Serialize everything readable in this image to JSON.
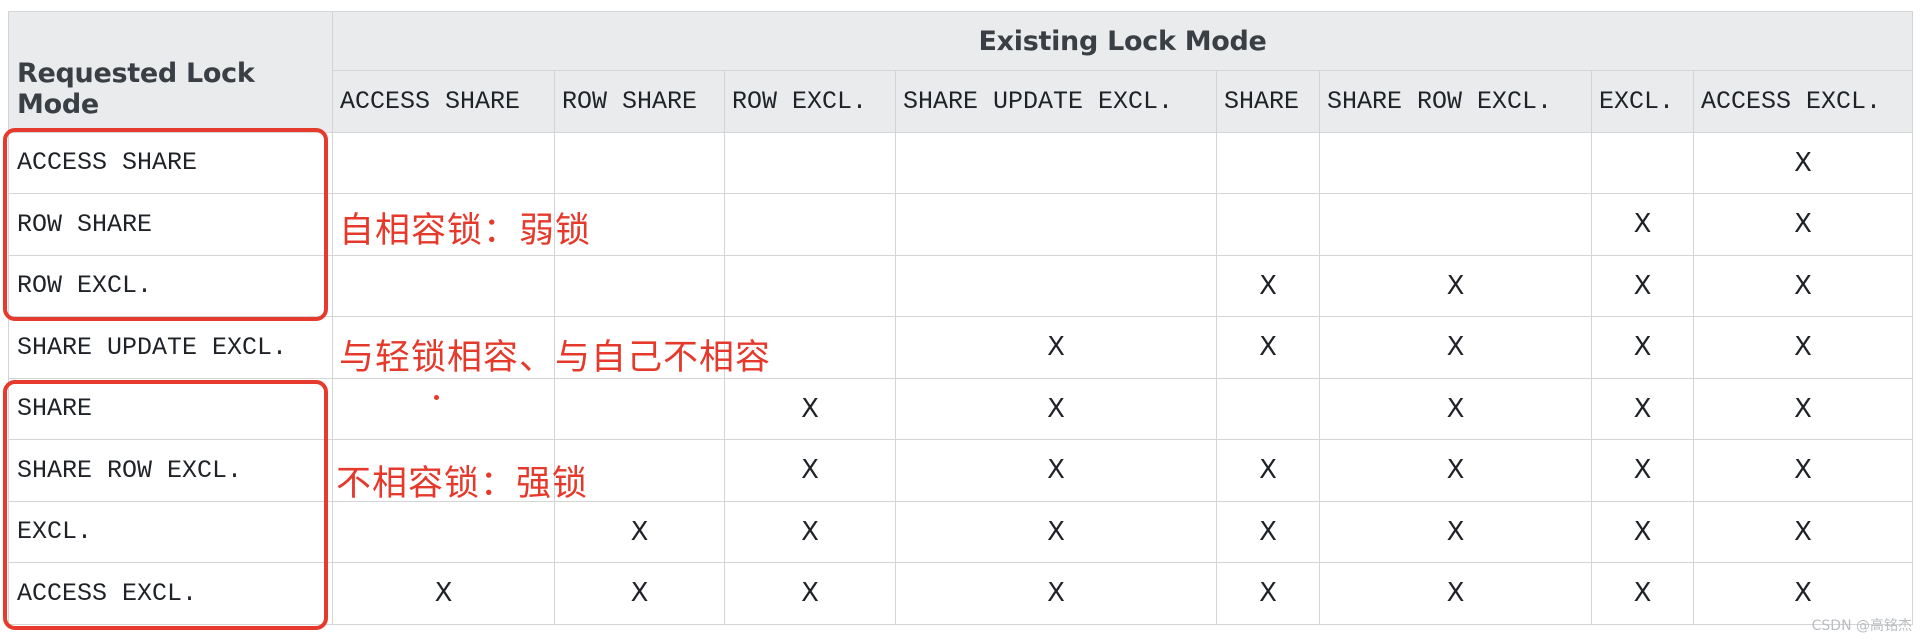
{
  "table": {
    "group_title": "Existing Lock Mode",
    "corner_label": "Requested Lock Mode",
    "columns": [
      "ACCESS SHARE",
      "ROW SHARE",
      "ROW EXCL.",
      "SHARE UPDATE EXCL.",
      "SHARE",
      "SHARE ROW EXCL.",
      "EXCL.",
      "ACCESS EXCL."
    ],
    "rows": [
      {
        "label": "ACCESS SHARE",
        "cells": [
          "",
          "",
          "",
          "",
          "",
          "",
          "",
          "X"
        ]
      },
      {
        "label": "ROW SHARE",
        "cells": [
          "",
          "",
          "",
          "",
          "",
          "",
          "X",
          "X"
        ]
      },
      {
        "label": "ROW EXCL.",
        "cells": [
          "",
          "",
          "",
          "",
          "X",
          "X",
          "X",
          "X"
        ]
      },
      {
        "label": "SHARE UPDATE EXCL.",
        "cells": [
          "",
          "",
          "",
          "X",
          "X",
          "X",
          "X",
          "X"
        ]
      },
      {
        "label": "SHARE",
        "cells": [
          "",
          "",
          "X",
          "X",
          "",
          "X",
          "X",
          "X"
        ]
      },
      {
        "label": "SHARE ROW EXCL.",
        "cells": [
          "",
          "",
          "X",
          "X",
          "X",
          "X",
          "X",
          "X"
        ]
      },
      {
        "label": "EXCL.",
        "cells": [
          "",
          "X",
          "X",
          "X",
          "X",
          "X",
          "X",
          "X"
        ]
      },
      {
        "label": "ACCESS EXCL.",
        "cells": [
          "X",
          "X",
          "X",
          "X",
          "X",
          "X",
          "X",
          "X"
        ]
      }
    ]
  },
  "annotations": {
    "weak": "自相容锁：弱锁",
    "middle": "与轻锁相容、与自己不相容",
    "strong": "不相容锁：强锁"
  },
  "watermark": "CSDN @高铭杰",
  "colors": {
    "annotation": "#e5392b",
    "header_bg": "#e9ebed",
    "border": "#d2d4d6"
  }
}
